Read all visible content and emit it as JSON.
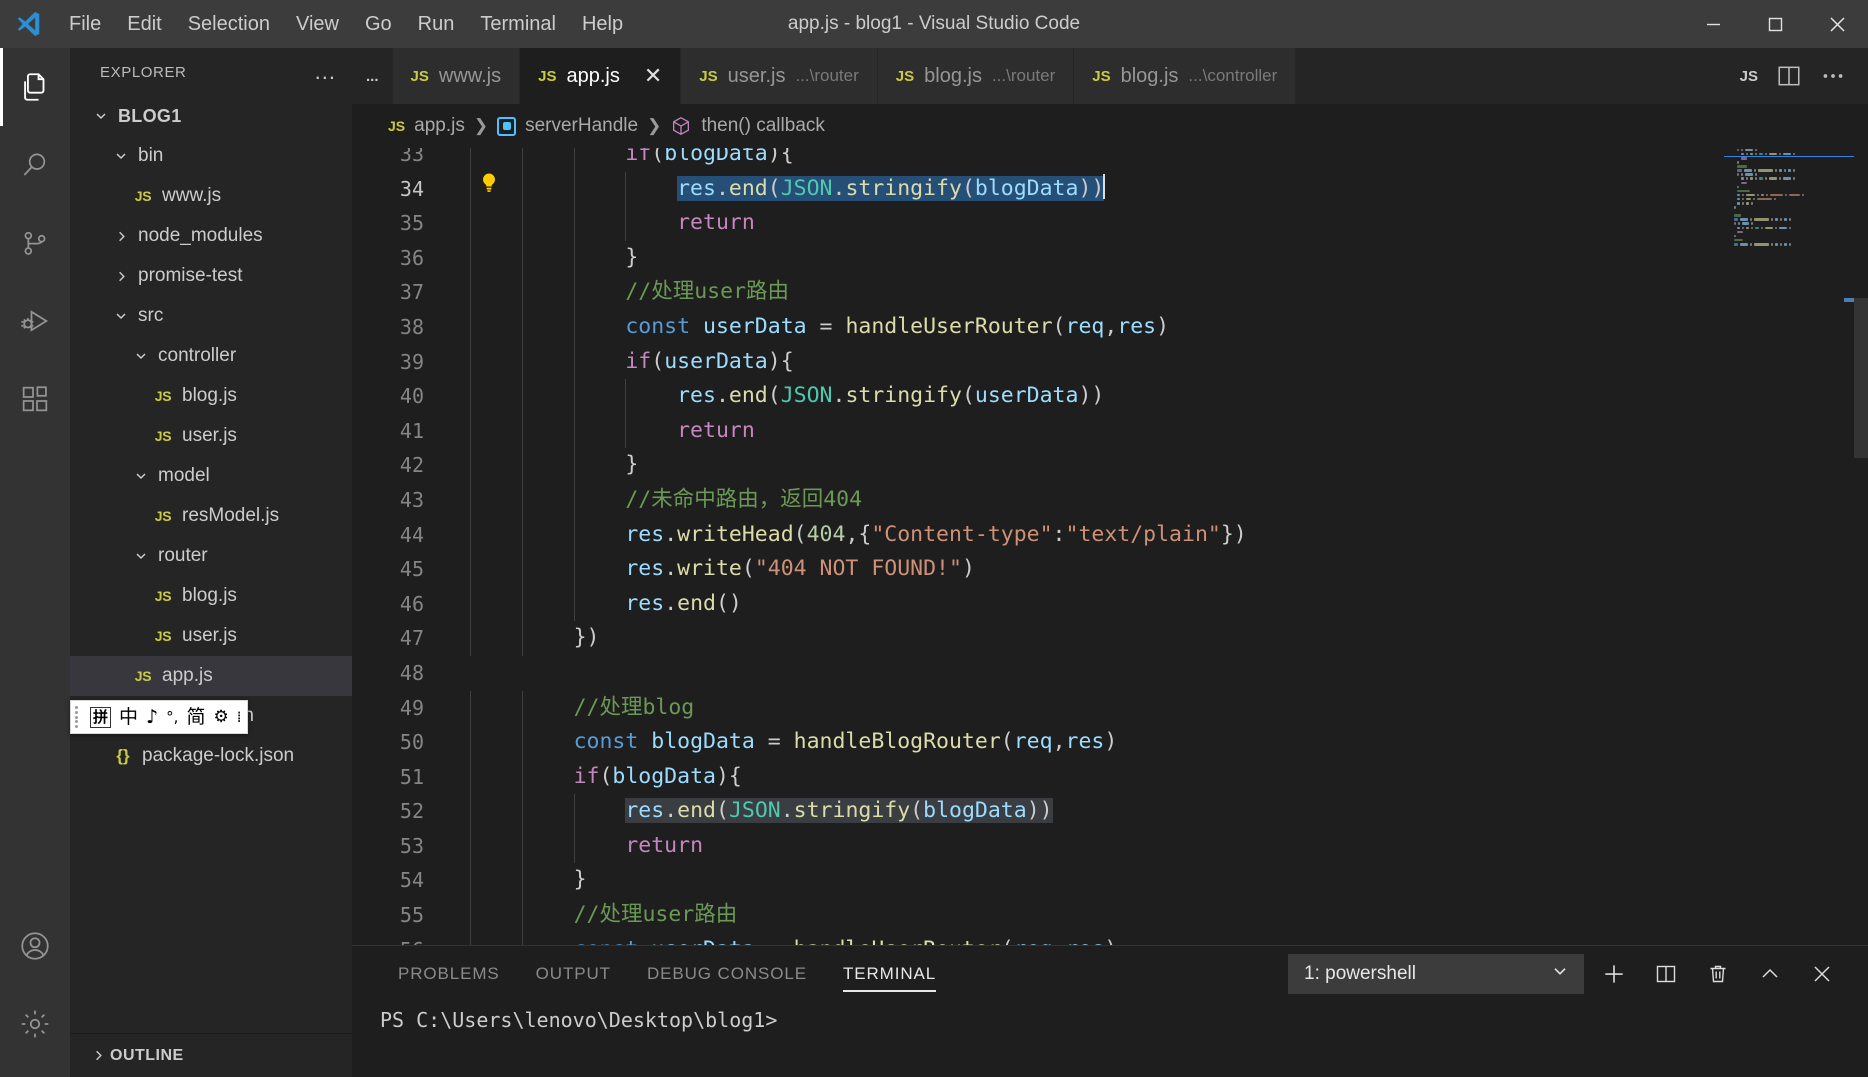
{
  "window": {
    "title": "app.js - blog1 - Visual Studio Code",
    "minimize_label": "Minimize",
    "maximize_label": "Maximize",
    "close_label": "Close"
  },
  "menubar": {
    "items": [
      "File",
      "Edit",
      "Selection",
      "View",
      "Go",
      "Run",
      "Terminal",
      "Help"
    ]
  },
  "activitybar": {
    "items": [
      {
        "name": "explorer",
        "icon": "files-icon"
      },
      {
        "name": "search",
        "icon": "search-icon"
      },
      {
        "name": "source-control",
        "icon": "source-control-icon"
      },
      {
        "name": "run-debug",
        "icon": "run-and-debug-icon"
      },
      {
        "name": "extensions",
        "icon": "extensions-icon"
      }
    ],
    "bottom": [
      {
        "name": "accounts",
        "icon": "account-icon"
      },
      {
        "name": "settings",
        "icon": "gear-icon"
      }
    ]
  },
  "sidebar": {
    "title": "EXPLORER",
    "more_actions": "...",
    "root": "BLOG1",
    "tree": [
      {
        "label": "bin",
        "type": "folder",
        "depth": 1,
        "expanded": true
      },
      {
        "label": "www.js",
        "type": "js",
        "depth": 2
      },
      {
        "label": "node_modules",
        "type": "folder",
        "depth": 1,
        "expanded": false
      },
      {
        "label": "promise-test",
        "type": "folder",
        "depth": 1,
        "expanded": false
      },
      {
        "label": "src",
        "type": "folder",
        "depth": 1,
        "expanded": true
      },
      {
        "label": "controller",
        "type": "folder",
        "depth": 2,
        "expanded": true
      },
      {
        "label": "blog.js",
        "type": "js",
        "depth": 3
      },
      {
        "label": "user.js",
        "type": "js",
        "depth": 3
      },
      {
        "label": "model",
        "type": "folder",
        "depth": 2,
        "expanded": true
      },
      {
        "label": "resModel.js",
        "type": "js",
        "depth": 3
      },
      {
        "label": "router",
        "type": "folder",
        "depth": 2,
        "expanded": true
      },
      {
        "label": "blog.js",
        "type": "js",
        "depth": 3
      },
      {
        "label": "user.js",
        "type": "js",
        "depth": 3
      },
      {
        "label": "app.js",
        "type": "js",
        "depth": 2,
        "selected": true
      },
      {
        "label": "package.json",
        "type": "json",
        "depth": 1
      },
      {
        "label": "package-lock.json",
        "type": "json",
        "depth": 1
      }
    ],
    "outline": "OUTLINE"
  },
  "ime": {
    "mode_box": "拼",
    "lang": "中",
    "sound": "♪",
    "punct": "°,",
    "simplified": "简",
    "gear": "⚙",
    "more": "⁞"
  },
  "tabs": {
    "overflow": "...",
    "items": [
      {
        "name": "www.js",
        "suffix": "",
        "active": false,
        "closable": false
      },
      {
        "name": "app.js",
        "suffix": "",
        "active": true,
        "closable": true
      },
      {
        "name": "user.js",
        "suffix": "...\\router",
        "active": false,
        "closable": false
      },
      {
        "name": "blog.js",
        "suffix": "...\\router",
        "active": false,
        "closable": false
      },
      {
        "name": "blog.js",
        "suffix": "...\\controller",
        "active": false,
        "closable": false
      }
    ],
    "partial": "JS",
    "split_editor": "Split Editor",
    "more_actions": "More Actions..."
  },
  "breadcrumb": {
    "file": "app.js",
    "symbol1": "serverHandle",
    "symbol2": "then() callback",
    "separator": "❯"
  },
  "editor": {
    "first_visible_line": 33,
    "cursor_line": 34,
    "lightbulb": "💡",
    "lines": [
      {
        "num": 33,
        "partial": true,
        "tokens": [
          {
            "t": "            ",
            "c": "pn"
          },
          {
            "t": "if",
            "c": "ctl"
          },
          {
            "t": "(",
            "c": "pn"
          },
          {
            "t": "blogData",
            "c": "var"
          },
          {
            "t": "){",
            "c": "pn"
          }
        ]
      },
      {
        "num": 34,
        "current": true,
        "selected": true,
        "caret": true,
        "tokens": [
          {
            "t": "                ",
            "c": "pn"
          },
          {
            "t": "res",
            "c": "var"
          },
          {
            "t": ".",
            "c": "pn"
          },
          {
            "t": "end",
            "c": "fn"
          },
          {
            "t": "(",
            "c": "pn"
          },
          {
            "t": "JSON",
            "c": "pl"
          },
          {
            "t": ".",
            "c": "pn"
          },
          {
            "t": "stringify",
            "c": "fn"
          },
          {
            "t": "(",
            "c": "pn"
          },
          {
            "t": "blogData",
            "c": "var"
          },
          {
            "t": "))",
            "c": "pn"
          }
        ]
      },
      {
        "num": 35,
        "tokens": [
          {
            "t": "                ",
            "c": "pn"
          },
          {
            "t": "return",
            "c": "ctl"
          }
        ]
      },
      {
        "num": 36,
        "tokens": [
          {
            "t": "            ",
            "c": "pn"
          },
          {
            "t": "}",
            "c": "pn"
          }
        ]
      },
      {
        "num": 37,
        "tokens": [
          {
            "t": "            ",
            "c": "pn"
          },
          {
            "t": "//处理user路由",
            "c": "cm"
          }
        ]
      },
      {
        "num": 38,
        "tokens": [
          {
            "t": "            ",
            "c": "pn"
          },
          {
            "t": "const",
            "c": "k"
          },
          {
            "t": " ",
            "c": "pn"
          },
          {
            "t": "userData",
            "c": "var"
          },
          {
            "t": " = ",
            "c": "pn"
          },
          {
            "t": "handleUserRouter",
            "c": "fn"
          },
          {
            "t": "(",
            "c": "pn"
          },
          {
            "t": "req",
            "c": "var"
          },
          {
            "t": ",",
            "c": "pn"
          },
          {
            "t": "res",
            "c": "var"
          },
          {
            "t": ")",
            "c": "pn"
          }
        ]
      },
      {
        "num": 39,
        "tokens": [
          {
            "t": "            ",
            "c": "pn"
          },
          {
            "t": "if",
            "c": "ctl"
          },
          {
            "t": "(",
            "c": "pn"
          },
          {
            "t": "userData",
            "c": "var"
          },
          {
            "t": "){",
            "c": "pn"
          }
        ]
      },
      {
        "num": 40,
        "tokens": [
          {
            "t": "                ",
            "c": "pn"
          },
          {
            "t": "res",
            "c": "var"
          },
          {
            "t": ".",
            "c": "pn"
          },
          {
            "t": "end",
            "c": "fn"
          },
          {
            "t": "(",
            "c": "pn"
          },
          {
            "t": "JSON",
            "c": "pl"
          },
          {
            "t": ".",
            "c": "pn"
          },
          {
            "t": "stringify",
            "c": "fn"
          },
          {
            "t": "(",
            "c": "pn"
          },
          {
            "t": "userData",
            "c": "var"
          },
          {
            "t": "))",
            "c": "pn"
          }
        ]
      },
      {
        "num": 41,
        "tokens": [
          {
            "t": "                ",
            "c": "pn"
          },
          {
            "t": "return",
            "c": "ctl"
          }
        ]
      },
      {
        "num": 42,
        "tokens": [
          {
            "t": "            ",
            "c": "pn"
          },
          {
            "t": "}",
            "c": "pn"
          }
        ]
      },
      {
        "num": 43,
        "tokens": [
          {
            "t": "            ",
            "c": "pn"
          },
          {
            "t": "//未命中路由，返回404",
            "c": "cm"
          }
        ]
      },
      {
        "num": 44,
        "tokens": [
          {
            "t": "            ",
            "c": "pn"
          },
          {
            "t": "res",
            "c": "var"
          },
          {
            "t": ".",
            "c": "pn"
          },
          {
            "t": "writeHead",
            "c": "fn"
          },
          {
            "t": "(",
            "c": "pn"
          },
          {
            "t": "404",
            "c": "num"
          },
          {
            "t": ",{",
            "c": "pn"
          },
          {
            "t": "\"Content-type\"",
            "c": "str"
          },
          {
            "t": ":",
            "c": "pn"
          },
          {
            "t": "\"text/plain\"",
            "c": "str"
          },
          {
            "t": "})",
            "c": "pn"
          }
        ]
      },
      {
        "num": 45,
        "tokens": [
          {
            "t": "            ",
            "c": "pn"
          },
          {
            "t": "res",
            "c": "var"
          },
          {
            "t": ".",
            "c": "pn"
          },
          {
            "t": "write",
            "c": "fn"
          },
          {
            "t": "(",
            "c": "pn"
          },
          {
            "t": "\"404 NOT FOUND!\"",
            "c": "str"
          },
          {
            "t": ")",
            "c": "pn"
          }
        ]
      },
      {
        "num": 46,
        "tokens": [
          {
            "t": "            ",
            "c": "pn"
          },
          {
            "t": "res",
            "c": "var"
          },
          {
            "t": ".",
            "c": "pn"
          },
          {
            "t": "end",
            "c": "fn"
          },
          {
            "t": "()",
            "c": "pn"
          }
        ]
      },
      {
        "num": 47,
        "tokens": [
          {
            "t": "        ",
            "c": "pn"
          },
          {
            "t": "})",
            "c": "pn"
          }
        ]
      },
      {
        "num": 48,
        "tokens": [
          {
            "t": "",
            "c": "pn"
          }
        ]
      },
      {
        "num": 49,
        "tokens": [
          {
            "t": "        ",
            "c": "pn"
          },
          {
            "t": "//处理blog",
            "c": "cm"
          }
        ]
      },
      {
        "num": 50,
        "tokens": [
          {
            "t": "        ",
            "c": "pn"
          },
          {
            "t": "const",
            "c": "k"
          },
          {
            "t": " ",
            "c": "pn"
          },
          {
            "t": "blogData",
            "c": "var"
          },
          {
            "t": " = ",
            "c": "pn"
          },
          {
            "t": "handleBlogRouter",
            "c": "fn"
          },
          {
            "t": "(",
            "c": "pn"
          },
          {
            "t": "req",
            "c": "var"
          },
          {
            "t": ",",
            "c": "pn"
          },
          {
            "t": "res",
            "c": "var"
          },
          {
            "t": ")",
            "c": "pn"
          }
        ]
      },
      {
        "num": 51,
        "tokens": [
          {
            "t": "        ",
            "c": "pn"
          },
          {
            "t": "if",
            "c": "ctl"
          },
          {
            "t": "(",
            "c": "pn"
          },
          {
            "t": "blogData",
            "c": "var"
          },
          {
            "t": "){",
            "c": "pn"
          }
        ]
      },
      {
        "num": 52,
        "weakselected": true,
        "tokens": [
          {
            "t": "            ",
            "c": "pn"
          },
          {
            "t": "res",
            "c": "var"
          },
          {
            "t": ".",
            "c": "pn"
          },
          {
            "t": "end",
            "c": "fn"
          },
          {
            "t": "(",
            "c": "pn"
          },
          {
            "t": "JSON",
            "c": "pl"
          },
          {
            "t": ".",
            "c": "pn"
          },
          {
            "t": "stringify",
            "c": "fn"
          },
          {
            "t": "(",
            "c": "pn"
          },
          {
            "t": "blogData",
            "c": "var"
          },
          {
            "t": "))",
            "c": "pn"
          }
        ]
      },
      {
        "num": 53,
        "tokens": [
          {
            "t": "            ",
            "c": "pn"
          },
          {
            "t": "return",
            "c": "ctl"
          }
        ]
      },
      {
        "num": 54,
        "tokens": [
          {
            "t": "        ",
            "c": "pn"
          },
          {
            "t": "}",
            "c": "pn"
          }
        ]
      },
      {
        "num": 55,
        "tokens": [
          {
            "t": "        ",
            "c": "pn"
          },
          {
            "t": "//处理user路由",
            "c": "cm"
          }
        ]
      },
      {
        "num": 56,
        "partial": true,
        "tokens": [
          {
            "t": "        ",
            "c": "pn"
          },
          {
            "t": "const",
            "c": "k"
          },
          {
            "t": " ",
            "c": "pn"
          },
          {
            "t": "userData",
            "c": "var"
          },
          {
            "t": " = ",
            "c": "pn"
          },
          {
            "t": "handleUserRouter",
            "c": "fn"
          },
          {
            "t": "(",
            "c": "pn"
          },
          {
            "t": "req",
            "c": "var"
          },
          {
            "t": ",",
            "c": "pn"
          },
          {
            "t": "res",
            "c": "var"
          },
          {
            "t": ")",
            "c": "pn"
          }
        ]
      }
    ]
  },
  "panel": {
    "tabs": [
      {
        "label": "PROBLEMS",
        "active": false
      },
      {
        "label": "OUTPUT",
        "active": false
      },
      {
        "label": "DEBUG CONSOLE",
        "active": false
      },
      {
        "label": "TERMINAL",
        "active": true
      }
    ],
    "terminal_select": "1: powershell",
    "actions": [
      {
        "name": "new-terminal-button",
        "icon": "plus-icon"
      },
      {
        "name": "split-terminal-button",
        "icon": "split-icon"
      },
      {
        "name": "kill-terminal-button",
        "icon": "trash-icon"
      },
      {
        "name": "maximize-panel-button",
        "icon": "chevron-up-icon"
      },
      {
        "name": "close-panel-button",
        "icon": "close-icon"
      }
    ],
    "terminal_prompt": "PS C:\\Users\\lenovo\\Desktop\\blog1>"
  },
  "colors": {
    "accent": "#007acc",
    "titlebar_bg": "#3c3c3c",
    "activitybar_bg": "#333333",
    "sidebar_bg": "#252526",
    "editor_bg": "#1e1e1e",
    "selection": "#264f78",
    "js_icon": "#cbcb41",
    "keyword": "#569cd6",
    "control": "#c586c0",
    "function": "#dcdcaa",
    "variable": "#9cdcfe",
    "string": "#ce9178",
    "comment": "#6a9955",
    "number": "#b5cea8"
  }
}
